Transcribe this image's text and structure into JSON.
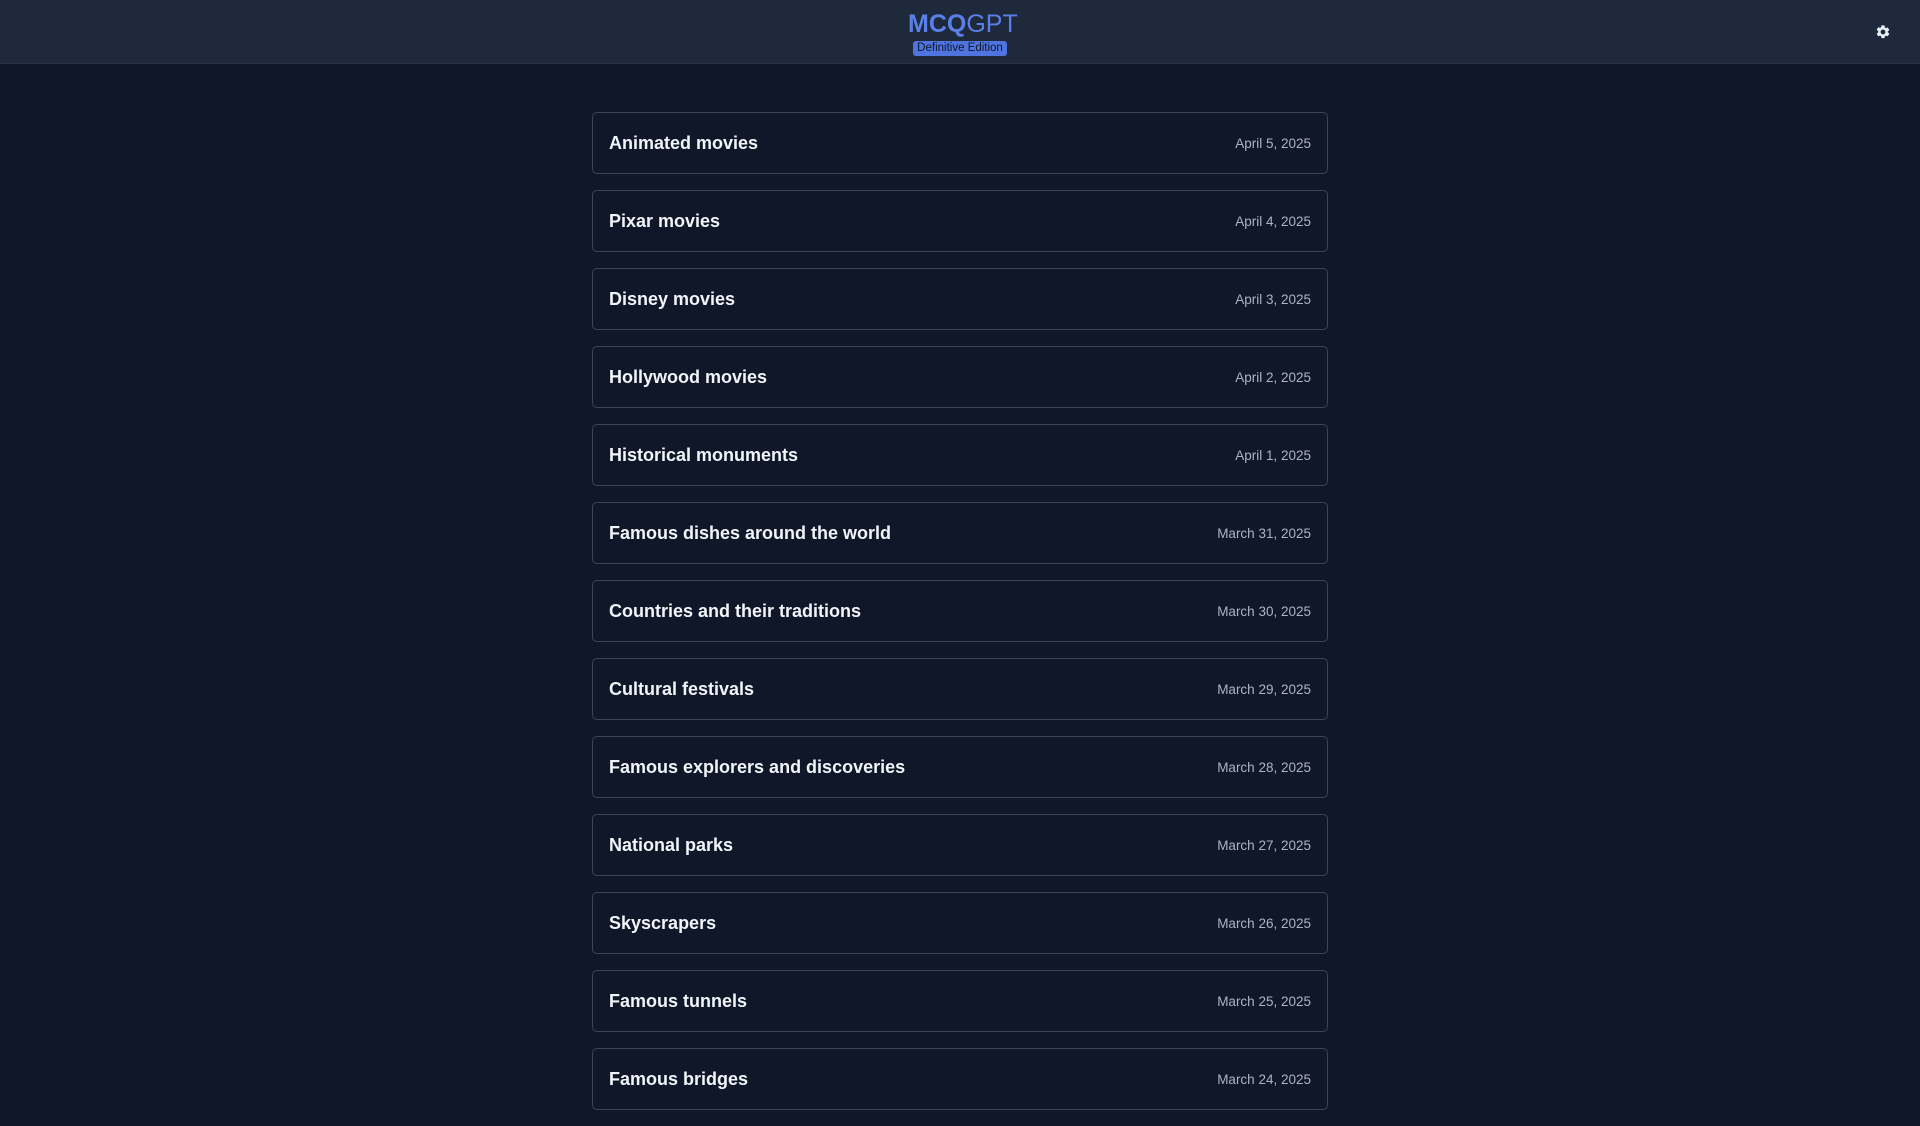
{
  "header": {
    "brand_bold": "MCQ",
    "brand_light": "GPT",
    "badge": "Definitive Edition",
    "settings_icon": "gear-icon"
  },
  "colors": {
    "background": "#0f1729",
    "header": "#1e293b",
    "accent": "#5b7fe8",
    "card_border": "#39465a"
  },
  "quizzes": [
    {
      "title": "Animated movies",
      "date": "April 5, 2025"
    },
    {
      "title": "Pixar movies",
      "date": "April 4, 2025"
    },
    {
      "title": "Disney movies",
      "date": "April 3, 2025"
    },
    {
      "title": "Hollywood movies",
      "date": "April 2, 2025"
    },
    {
      "title": "Historical monuments",
      "date": "April 1, 2025"
    },
    {
      "title": "Famous dishes around the world",
      "date": "March 31, 2025"
    },
    {
      "title": "Countries and their traditions",
      "date": "March 30, 2025"
    },
    {
      "title": "Cultural festivals",
      "date": "March 29, 2025"
    },
    {
      "title": "Famous explorers and discoveries",
      "date": "March 28, 2025"
    },
    {
      "title": "National parks",
      "date": "March 27, 2025"
    },
    {
      "title": "Skyscrapers",
      "date": "March 26, 2025"
    },
    {
      "title": "Famous tunnels",
      "date": "March 25, 2025"
    },
    {
      "title": "Famous bridges",
      "date": "March 24, 2025"
    }
  ]
}
